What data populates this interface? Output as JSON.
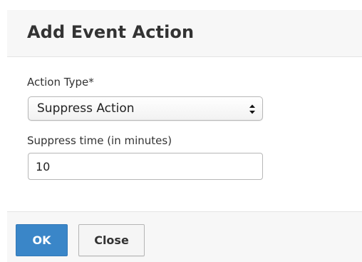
{
  "dialog": {
    "title": "Add Event Action"
  },
  "form": {
    "action_type": {
      "label": "Action Type*",
      "selected": "Suppress Action"
    },
    "suppress_time": {
      "label": "Suppress time (in minutes)",
      "value": "10"
    }
  },
  "footer": {
    "ok_label": "OK",
    "close_label": "Close"
  },
  "colors": {
    "primary_button": "#3a86c8",
    "header_background": "#f7f7f7",
    "footer_background": "#f7f7f7"
  },
  "icons": {
    "select_arrow": "up-down-chevron-icon"
  }
}
